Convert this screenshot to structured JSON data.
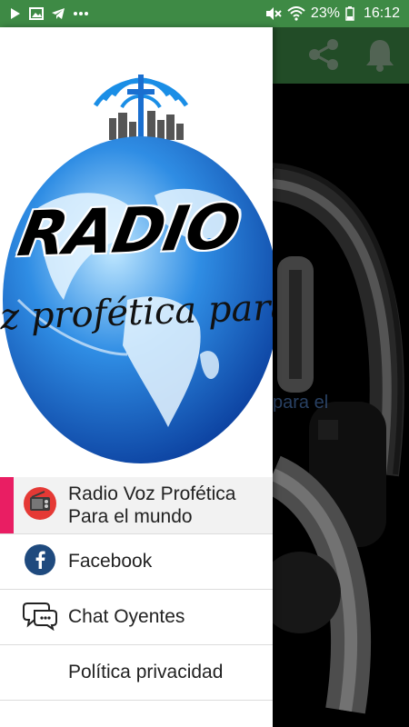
{
  "status_bar": {
    "battery": "23%",
    "time": "16:12",
    "left_icons": [
      "play-icon",
      "image-icon",
      "telegram-icon",
      "more-dots-icon"
    ],
    "right_icons": [
      "mute-icon",
      "wifi-icon",
      "battery-icon"
    ],
    "color": "#3e8a45"
  },
  "app": {
    "toolbar_color": "#3f8a48",
    "actions": [
      "share-icon",
      "bell-icon"
    ],
    "background_text": "para el"
  },
  "drawer": {
    "header": {
      "logo_title": "RADIO",
      "logo_slogan": "z profética para e"
    },
    "items": [
      {
        "label": "Radio Voz Profética\nPara el mundo",
        "icon": "radio-icon",
        "active": true
      },
      {
        "label": "Facebook",
        "icon": "facebook-icon",
        "active": false
      },
      {
        "label": "Chat Oyentes",
        "icon": "chat-icon",
        "active": false
      },
      {
        "label": "Política privacidad",
        "icon": "",
        "active": false
      }
    ],
    "accent_color": "#e91e63"
  }
}
